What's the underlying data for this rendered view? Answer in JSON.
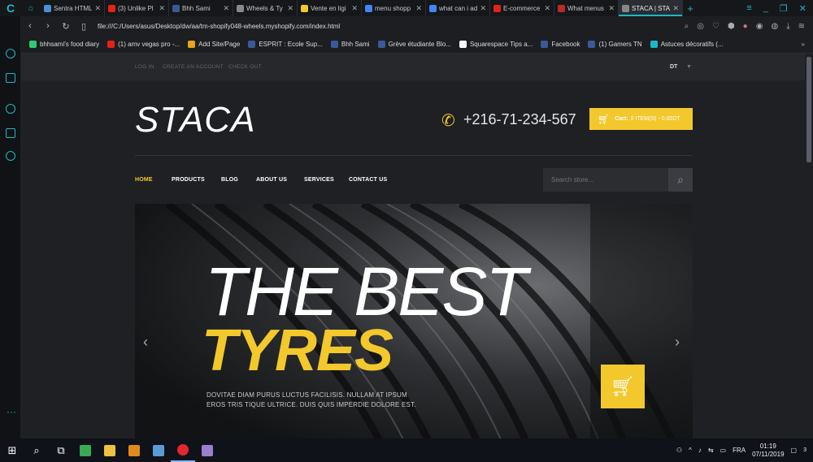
{
  "tabs": [
    {
      "title": "Sentra HTML",
      "color": "#4a90d9"
    },
    {
      "title": "(3) Unlike Pl",
      "color": "#e62117"
    },
    {
      "title": "Bhh Sami",
      "color": "#3b5998"
    },
    {
      "title": "Wheels & Ty",
      "color": "#888888"
    },
    {
      "title": "Vente en ligi",
      "color": "#f2c82c"
    },
    {
      "title": "menu shopp",
      "color": "#4285f4"
    },
    {
      "title": "what can i ad",
      "color": "#4285f4"
    },
    {
      "title": "E-commerce",
      "color": "#e62117"
    },
    {
      "title": "What menus",
      "color": "#b92b27"
    },
    {
      "title": "STACA | STAC",
      "color": "#888888"
    }
  ],
  "address": {
    "url": "file:///C:/Users/asus/Desktop/dw/aa/tm-shopify048-wheels.myshopify.com/index.html"
  },
  "bookmarks": [
    {
      "label": "bhhsami's food diary",
      "color": "#2ecc71"
    },
    {
      "label": "(1) amv vegas pro -...",
      "color": "#e62117"
    },
    {
      "label": "Add Site/Page",
      "color": "#e8a317"
    },
    {
      "label": "ESPRIT : Ecole Sup...",
      "color": "#3b5998"
    },
    {
      "label": "Bhh Sami",
      "color": "#3b5998"
    },
    {
      "label": "Grève étudiante Blo...",
      "color": "#3b5998"
    },
    {
      "label": "Squarespace Tips a...",
      "color": "#ffffff"
    },
    {
      "label": "Facebook",
      "color": "#3b5998"
    },
    {
      "label": "(1) Gamers TN",
      "color": "#3b5998"
    },
    {
      "label": "Astuces décoratifs (...",
      "color": "#1bb8c9"
    }
  ],
  "site": {
    "top_links": {
      "login": "LOG IN",
      "create": "CREATE AN ACCOUNT",
      "checkout": "CHECK OUT"
    },
    "currency": "DT",
    "brand": "STACA",
    "phone": "+216-71-234-567",
    "cart": {
      "label": "Cart:",
      "count": "0 ITEM(S) - 0.00DT"
    },
    "nav": {
      "home": "HOME",
      "products": "PRODUCTS",
      "blog": "BLOG",
      "about": "ABOUT US",
      "services": "SERVICES",
      "contact": "CONTACT US"
    },
    "search_placeholder": "Search store...",
    "hero": {
      "line1": "THE BEST",
      "line2": "TYRES",
      "desc": "DOVITAE DIAM PURUS LUCTUS FACILISIS. NULLAM AT IPSUM EROS TRIS TIQUE ULTRICE. DUIS QUIS IMPERDIE DOLORE EST."
    }
  },
  "taskbar": {
    "lang": "FRA",
    "time": "01:19",
    "date": "07/11/2019",
    "notif": "3"
  },
  "colors": {
    "accent": "#f2c82c",
    "browser_accent": "#1bb8c9"
  }
}
